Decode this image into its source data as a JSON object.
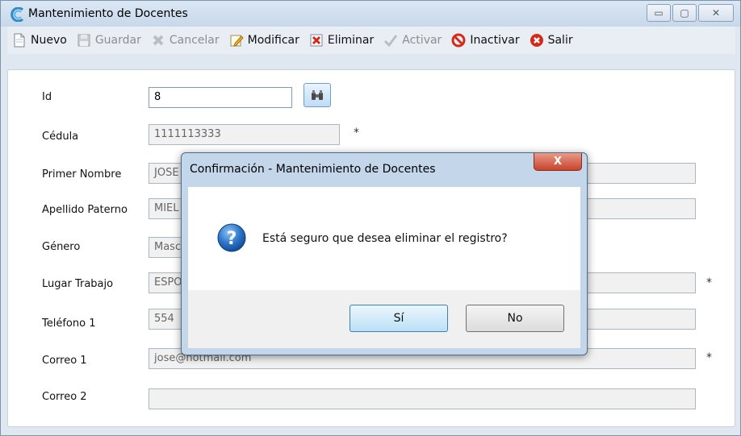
{
  "window": {
    "title": "Mantenimiento de Docentes",
    "controls": {
      "minimize": "▭",
      "maximize": "▢",
      "close": "✕"
    }
  },
  "toolbar": {
    "nuevo": "Nuevo",
    "guardar": "Guardar",
    "cancelar": "Cancelar",
    "modificar": "Modificar",
    "eliminar": "Eliminar",
    "activar": "Activar",
    "inactivar": "Inactivar",
    "salir": "Salir"
  },
  "form": {
    "id": {
      "label": "Id",
      "value": "8"
    },
    "cedula": {
      "label": "Cédula",
      "value": "1111113333",
      "required": "*"
    },
    "primer_nombre": {
      "label": "Primer Nombre",
      "value": "JOSE"
    },
    "apellido_paterno": {
      "label": "Apellido Paterno",
      "value": "MIEL"
    },
    "genero": {
      "label": "Género",
      "value": "Masc"
    },
    "lugar_trabajo": {
      "label": "Lugar Trabajo",
      "value": "ESPO",
      "required": "*"
    },
    "telefono1": {
      "label": "Teléfono 1",
      "value": "554"
    },
    "correo1": {
      "label": "Correo 1",
      "value": "jose@hotmail.com",
      "required": "*"
    },
    "correo2": {
      "label": "Correo 2",
      "value": ""
    }
  },
  "dialog": {
    "title": "Confirmación - Mantenimiento de Docentes",
    "close": "X",
    "message": "Está seguro que desea eliminar el registro?",
    "yes": "Sí",
    "no": "No",
    "icon": "question-icon"
  },
  "colors": {
    "accent": "#3c7fb1",
    "question_icon": "#1f64b8",
    "delete_red": "#d42a1a"
  }
}
